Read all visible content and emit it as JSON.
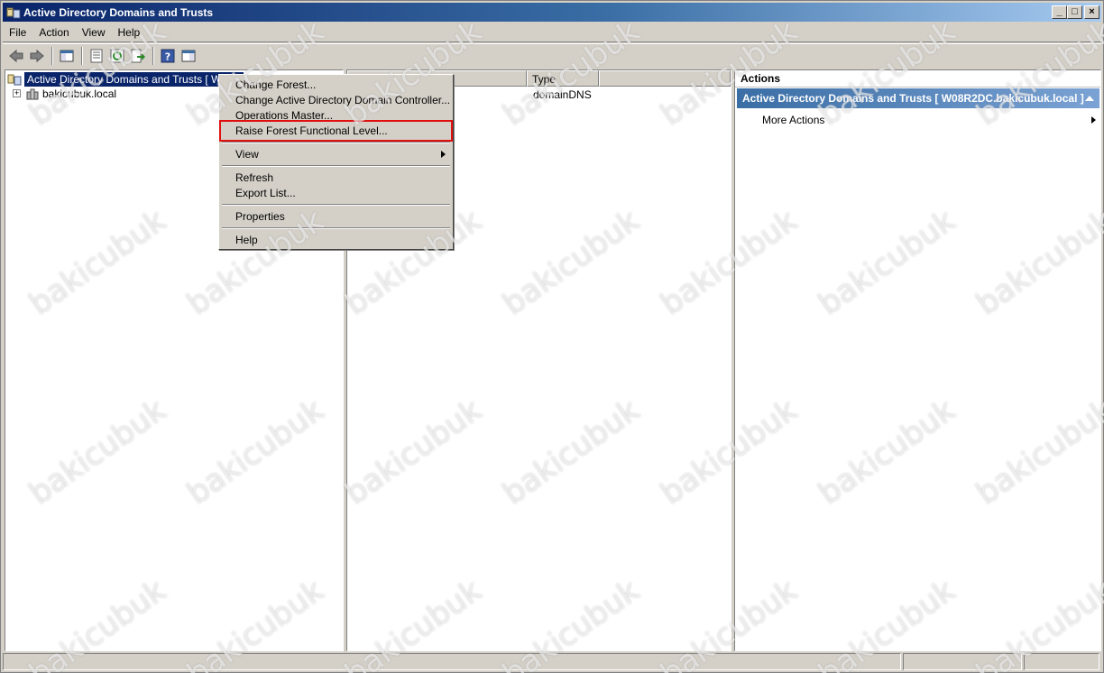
{
  "window": {
    "title": "Active Directory Domains and Trusts",
    "controls": {
      "minimize": "_",
      "maximize": "□",
      "close": "×"
    }
  },
  "menubar": {
    "items": [
      "File",
      "Action",
      "View",
      "Help"
    ]
  },
  "toolbar": {
    "icons": [
      "back-icon",
      "forward-icon",
      "show-hide-tree-icon",
      "properties-icon",
      "refresh-icon",
      "export-list-icon",
      "help-icon",
      "show-hide-action-pane-icon"
    ]
  },
  "tree": {
    "root_label": "Active Directory Domains and Trusts [ W08R",
    "child_label": "bakicubuk.local",
    "expander": "+"
  },
  "list": {
    "columns": [
      "",
      "Type"
    ],
    "rows": [
      {
        "name": "",
        "type": "domainDNS"
      }
    ]
  },
  "actions": {
    "header": "Actions",
    "section_title": "Active Directory Domains and Trusts [ W08R2DC.bakicubuk.local ]",
    "items": [
      "More Actions"
    ]
  },
  "context_menu": {
    "items": [
      "Change Forest...",
      "Change Active Directory Domain Controller...",
      "Operations Master...",
      "Raise Forest Functional Level...",
      "View",
      "Refresh",
      "Export List...",
      "Properties",
      "Help"
    ],
    "highlighted": "Raise Forest Functional Level..."
  },
  "watermark": "bakicubuk",
  "colors": {
    "title_start": "#0a246a",
    "title_end": "#a6caf0",
    "selection": "#0a246a",
    "highlight_box": "#e01010",
    "chrome": "#d4d0c8"
  }
}
